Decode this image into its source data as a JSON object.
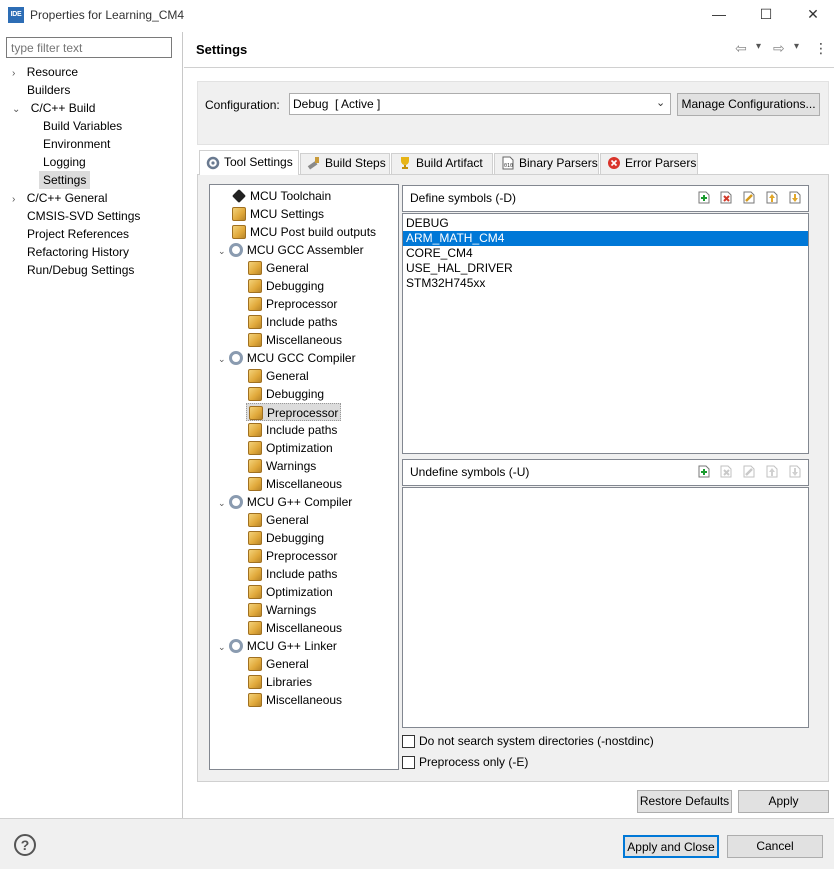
{
  "window": {
    "icon_text": "IDE",
    "title": "Properties for Learning_CM4",
    "minimize_glyph": "—",
    "maximize_glyph": "☐",
    "close_glyph": "✕"
  },
  "left_pane": {
    "filter_placeholder": "type filter text",
    "items": [
      {
        "label": "Resource",
        "expander": "›"
      },
      {
        "label": "Builders"
      },
      {
        "label": "C/C++ Build",
        "expander": "⌄"
      },
      {
        "label": "Build Variables"
      },
      {
        "label": "Environment"
      },
      {
        "label": "Logging"
      },
      {
        "label": "Settings",
        "selected": true
      },
      {
        "label": "C/C++ General",
        "expander": "›"
      },
      {
        "label": "CMSIS-SVD Settings"
      },
      {
        "label": "Project References"
      },
      {
        "label": "Refactoring History"
      },
      {
        "label": "Run/Debug Settings"
      }
    ]
  },
  "header": {
    "title": "Settings",
    "back_glyph": "⇦",
    "back_menu_glyph": "▾",
    "forward_glyph": "⇨",
    "forward_menu_glyph": "▾",
    "menu_glyph": "⋮"
  },
  "configuration": {
    "label": "Configuration:",
    "value": "Debug  [ Active ]",
    "chevron": "⌄",
    "manage_button": "Manage Configurations..."
  },
  "tabs": [
    {
      "label": "Tool Settings",
      "icon": "tool-settings-icon",
      "active": true
    },
    {
      "label": "Build Steps",
      "icon": "build-steps-icon"
    },
    {
      "label": "Build Artifact",
      "icon": "trophy-icon"
    },
    {
      "label": "Binary Parsers",
      "icon": "binary-icon"
    },
    {
      "label": "Error Parsers",
      "icon": "error-icon"
    }
  ],
  "tool_tree": {
    "expanded_glyph": "⌄",
    "rows": [
      {
        "label": "MCU Toolchain",
        "icon": "chip"
      },
      {
        "label": "MCU Settings",
        "icon": "tool"
      },
      {
        "label": "MCU Post build outputs",
        "icon": "tool"
      },
      {
        "label": "MCU GCC Assembler",
        "icon": "gear",
        "expanded": true
      },
      {
        "label": "General",
        "icon": "tool",
        "child": true
      },
      {
        "label": "Debugging",
        "icon": "tool",
        "child": true
      },
      {
        "label": "Preprocessor",
        "icon": "tool",
        "child": true
      },
      {
        "label": "Include paths",
        "icon": "tool",
        "child": true
      },
      {
        "label": "Miscellaneous",
        "icon": "tool",
        "child": true
      },
      {
        "label": "MCU GCC Compiler",
        "icon": "gear",
        "expanded": true
      },
      {
        "label": "General",
        "icon": "tool",
        "child": true
      },
      {
        "label": "Debugging",
        "icon": "tool",
        "child": true
      },
      {
        "label": "Preprocessor",
        "icon": "tool",
        "child": true,
        "selected": true
      },
      {
        "label": "Include paths",
        "icon": "tool",
        "child": true
      },
      {
        "label": "Optimization",
        "icon": "tool",
        "child": true
      },
      {
        "label": "Warnings",
        "icon": "tool",
        "child": true
      },
      {
        "label": "Miscellaneous",
        "icon": "tool",
        "child": true
      },
      {
        "label": "MCU G++ Compiler",
        "icon": "gear",
        "expanded": true
      },
      {
        "label": "General",
        "icon": "tool",
        "child": true
      },
      {
        "label": "Debugging",
        "icon": "tool",
        "child": true
      },
      {
        "label": "Preprocessor",
        "icon": "tool",
        "child": true
      },
      {
        "label": "Include paths",
        "icon": "tool",
        "child": true
      },
      {
        "label": "Optimization",
        "icon": "tool",
        "child": true
      },
      {
        "label": "Warnings",
        "icon": "tool",
        "child": true
      },
      {
        "label": "Miscellaneous",
        "icon": "tool",
        "child": true
      },
      {
        "label": "MCU G++ Linker",
        "icon": "gear",
        "expanded": true
      },
      {
        "label": "General",
        "icon": "tool",
        "child": true
      },
      {
        "label": "Libraries",
        "icon": "tool",
        "child": true
      },
      {
        "label": "Miscellaneous",
        "icon": "tool",
        "child": true
      }
    ]
  },
  "define_symbols": {
    "title": "Define symbols (-D)",
    "items": [
      "DEBUG",
      "ARM_MATH_CM4",
      "CORE_CM4",
      "USE_HAL_DRIVER",
      "STM32H745xx"
    ],
    "selected_index": 1,
    "toolbar": [
      "add-icon",
      "delete-icon",
      "edit-icon",
      "move-up-icon",
      "move-down-icon"
    ]
  },
  "undefine_symbols": {
    "title": "Undefine symbols (-U)",
    "items": []
  },
  "options": {
    "nostdinc_label": "Do not search system directories (-nostdinc)",
    "nostdinc_checked": false,
    "preprocess_only_label": "Preprocess only (-E)",
    "preprocess_only_checked": false
  },
  "buttons": {
    "restore_defaults": "Restore Defaults",
    "apply": "Apply",
    "apply_and_close": "Apply and Close",
    "cancel": "Cancel",
    "help_glyph": "?"
  }
}
